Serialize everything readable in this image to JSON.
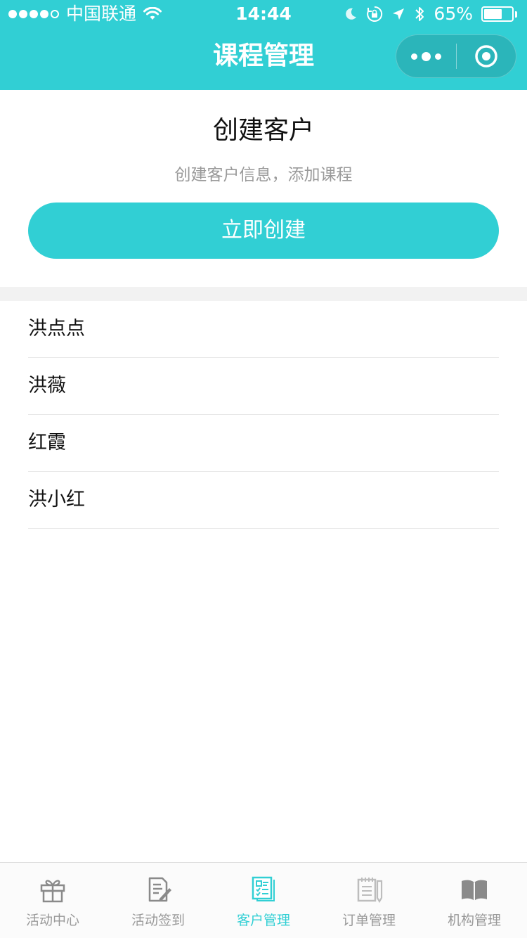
{
  "status_bar": {
    "carrier": "中国联通",
    "time": "14:44",
    "battery": "65%",
    "battery_level": 0.65
  },
  "nav": {
    "title": "课程管理"
  },
  "create_card": {
    "title": "创建客户",
    "subtitle": "创建客户信息，添加课程",
    "button_label": "立即创建"
  },
  "customers": [
    "洪点点",
    "洪薇",
    "红霞",
    "洪小红"
  ],
  "tabs": [
    {
      "label": "活动中心",
      "icon": "gift-icon",
      "active": false
    },
    {
      "label": "活动签到",
      "icon": "sign-in-edit-icon",
      "active": false
    },
    {
      "label": "客户管理",
      "icon": "customer-list-icon",
      "active": true
    },
    {
      "label": "订单管理",
      "icon": "order-notepad-icon",
      "active": false
    },
    {
      "label": "机构管理",
      "icon": "book-icon",
      "active": false
    }
  ],
  "colors": {
    "accent": "#31cfd4",
    "inactive_tab": "#999999",
    "inactive_icon": "#8a8a8a",
    "disabled_icon": "#bdbdbd"
  }
}
